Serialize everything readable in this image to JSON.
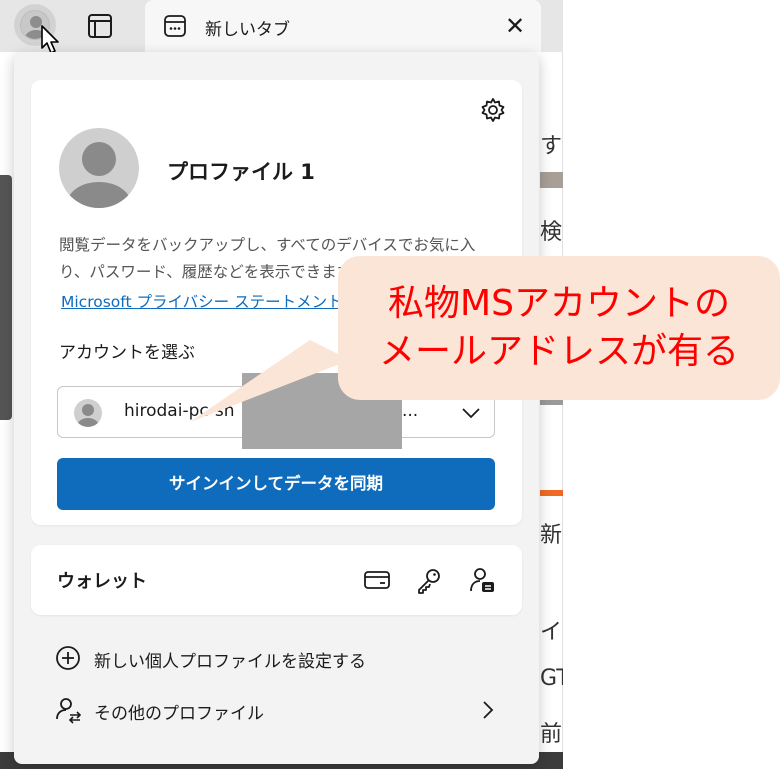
{
  "browser": {
    "tab": {
      "title": "新しいタブ",
      "close_glyph": "✕"
    }
  },
  "background_page": {
    "fragments": [
      "する",
      "検",
      "新台",
      "イッ",
      "GTO",
      "前ガ"
    ]
  },
  "profile_flyout": {
    "profile_name": "プロファイル 1",
    "description": "閲覧データをバックアップし、すべてのデバイスでお気に入り、パスワード、履歴などを表示できます。",
    "privacy_link": "Microsoft プライバシー ステートメント",
    "choose_account_label": "アカウントを選ぶ",
    "account": {
      "email": "hirodai-pc-sh",
      "ellipsis": "..."
    },
    "signin_button": "サインインしてデータを同期",
    "wallet": {
      "label": "ウォレット",
      "icons": [
        "card-icon",
        "key-icon",
        "personal-info-icon"
      ]
    },
    "new_profile": "新しい個人プロファイルを設定する",
    "other_profiles": "その他のプロファイル"
  },
  "callout": {
    "line1": "私物MSアカウントの",
    "line2": "メールアドレスが有る",
    "fill": "#fbe5d6",
    "text_color": "#ff0000"
  },
  "colors": {
    "accent": "#0f6cbd",
    "flyout_bg": "#f3f3f3"
  }
}
